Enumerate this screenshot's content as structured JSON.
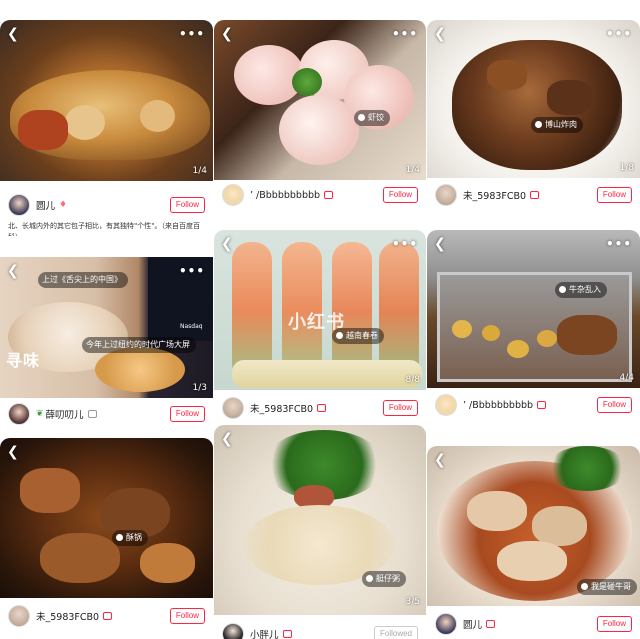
{
  "cards": [
    {
      "counter": "1/4",
      "user": "圆儿",
      "follow": "Follow",
      "desc": "北、长城内外的其它包子相比，有其独特\"个性\"。（来自百度百科）"
    },
    {
      "counter": "1/4",
      "tag": "虾饺",
      "user": "’ /Bbbbbbbbbb",
      "follow": "Follow"
    },
    {
      "counter": "1/8",
      "tag": "博山炸肉",
      "user": "未_5983FCB0",
      "follow": "Follow"
    },
    {
      "counter": "1/3",
      "tag1": "上过《舌尖上的中国》",
      "tag2": "今年上过纽约的时代广场大屏",
      "sign": "Nasdaq",
      "user": "薛叨叨儿",
      "follow": "Follow"
    },
    {
      "counter": "8/8",
      "tag": "越南春卷",
      "watermark": "小红书",
      "user": "未_5983FCB0",
      "follow": "Follow"
    },
    {
      "counter": "4/4",
      "tag": "牛杂乱入",
      "user": "’ /Bbbbbbbbbb",
      "follow": "Follow"
    },
    {
      "tag": "酥锅",
      "user": "未_5983FCB0",
      "follow": "Follow"
    },
    {
      "counter": "3/5",
      "tag": "艇仔粥",
      "user": "小胖儿",
      "follow": "Followed"
    },
    {
      "tag": "我是碰牛哥",
      "user": "圆儿",
      "follow": "Follow"
    }
  ],
  "icons": {
    "back": "chevron-left-icon",
    "more": "more-dots-icon"
  }
}
